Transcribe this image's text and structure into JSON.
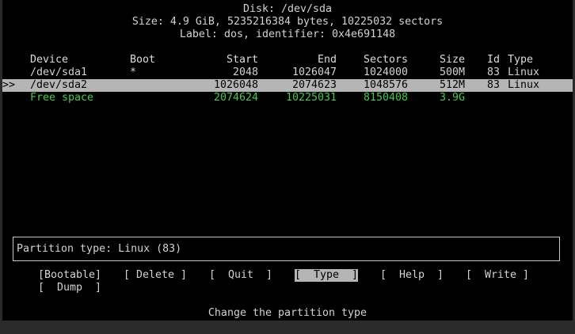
{
  "header": {
    "disk_line": "Disk: /dev/sda",
    "size_line": "Size: 4.9 GiB, 5235216384 bytes, 10225032 sectors",
    "label_line": "Label: dos, identifier: 0x4e691148"
  },
  "table": {
    "columns": {
      "device": "Device",
      "boot": "Boot",
      "start": "Start",
      "end": "End",
      "sectors": "Sectors",
      "size": "Size",
      "id": "Id",
      "type": "Type"
    },
    "cursor": ">>",
    "rows": [
      {
        "device": "/dev/sda1",
        "boot": "*",
        "start": "2048",
        "end": "1026047",
        "sectors": "1024000",
        "size": "500M",
        "id": "83",
        "type": "Linux"
      },
      {
        "device": "/dev/sda2",
        "boot": "",
        "start": "1026048",
        "end": "2074623",
        "sectors": "1048576",
        "size": "512M",
        "id": "83",
        "type": "Linux"
      },
      {
        "device": "Free space",
        "boot": "",
        "start": "2074624",
        "end": "10225031",
        "sectors": "8150408",
        "size": "3.9G",
        "id": "",
        "type": ""
      }
    ]
  },
  "info_box": {
    "text": "Partition type: Linux (83)"
  },
  "menu": {
    "bootable": "[Bootable]",
    "delete": "[ Delete ]",
    "quit": "[  Quit  ]",
    "type": "[  Type  ]",
    "help": "[  Help  ]",
    "write": "[  Write ]",
    "dump": "[  Dump  ]"
  },
  "status_line": "Change the partition type",
  "colors": {
    "background": "#000000",
    "text": "#d2d2d2",
    "free_space": "#48c850",
    "highlight": "#b5b5b5"
  }
}
